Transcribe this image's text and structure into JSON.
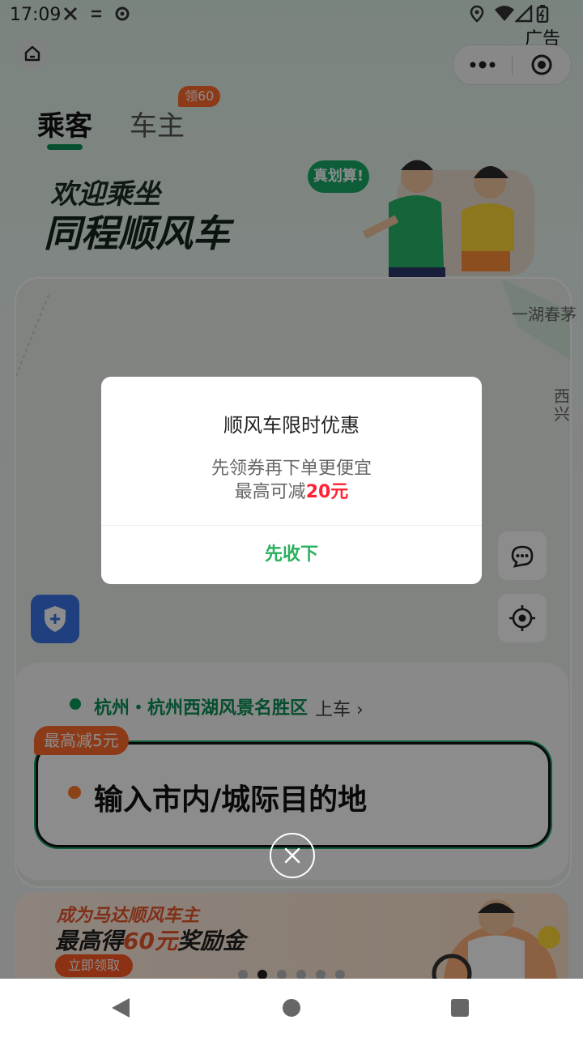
{
  "status_bar": {
    "time": "17:09"
  },
  "header": {
    "ad_label": "广告"
  },
  "tabs": [
    {
      "label": "乘客"
    },
    {
      "label": "车主"
    }
  ],
  "driver_tab_badge": "领60",
  "hero": {
    "line1": "欢迎乘坐",
    "line2": "同程顺风车",
    "bubble": "真划算!"
  },
  "map": {
    "label_1": "一湖春茅",
    "label_2": "西兴"
  },
  "pickup": {
    "location": "杭州・杭州西湖风景名胜区",
    "suffix": "上车 ›"
  },
  "destination": {
    "badge": "最高减5元",
    "placeholder": "输入市内/城际目的地"
  },
  "banner": {
    "line1": "成为马达顺风车主",
    "line2_prefix": "最高得",
    "line2_amount": "60元",
    "line2_suffix": "奖励金",
    "button": "立即领取",
    "page_count": 6,
    "active_page": 2
  },
  "modal": {
    "title": "顺风车限时优惠",
    "line1": "先领券再下单更便宜",
    "line2_prefix": "最高可减",
    "line2_amount": "20元",
    "confirm": "先收下"
  },
  "colors": {
    "brand_green": "#0a8f55",
    "confirm_green": "#2ab15d",
    "highlight_red": "#ff2233",
    "badge_orange": "#ff6a2b"
  }
}
